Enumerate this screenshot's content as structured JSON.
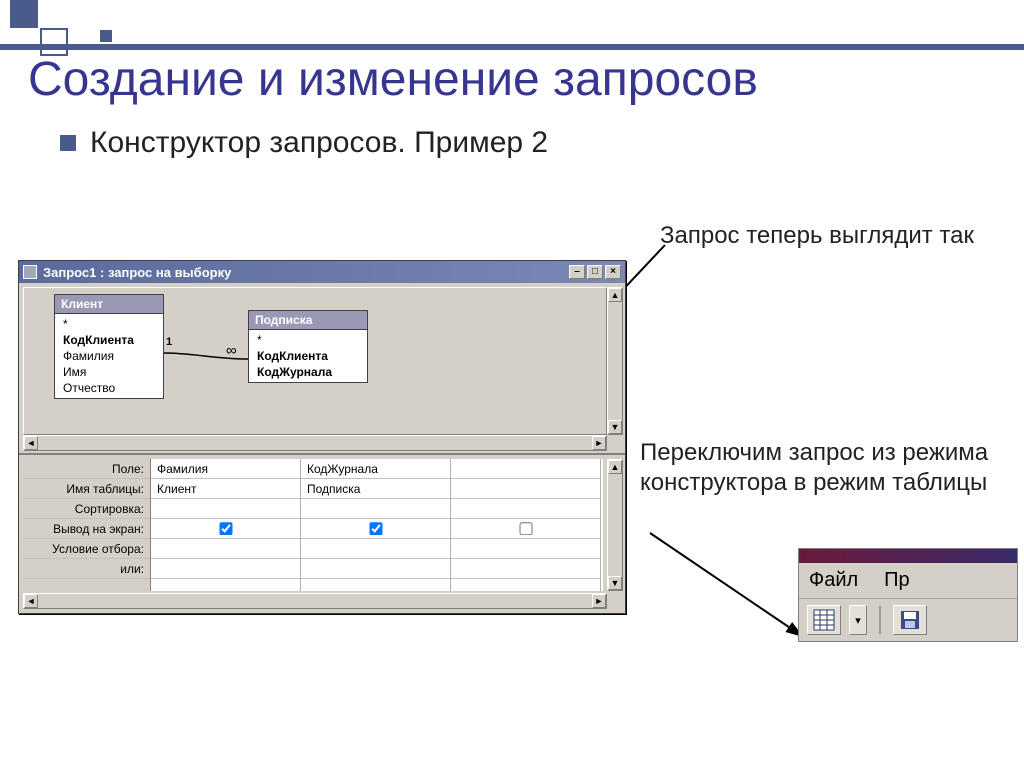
{
  "decoration": {},
  "slide": {
    "title": "Создание и изменение запросов",
    "subtitle": "Конструктор запросов. Пример 2"
  },
  "annotations": {
    "note1": "Запрос теперь выглядит так",
    "note2": "Переключим запрос из режима конструктора в режим таблицы"
  },
  "access_window": {
    "title": "Запрос1 : запрос на выборку",
    "tables": {
      "client": {
        "title": "Клиент",
        "fields": [
          "*",
          "КодКлиента",
          "Фамилия",
          "Имя",
          "Отчество"
        ],
        "bold_indices": [
          1
        ]
      },
      "subscription": {
        "title": "Подписка",
        "fields": [
          "*",
          "КодКлиента",
          "КодЖурнала"
        ],
        "bold_indices": [
          1,
          2
        ]
      }
    },
    "relation": {
      "left": "1",
      "right": "∞"
    },
    "grid_labels": [
      "Поле:",
      "Имя таблицы:",
      "Сортировка:",
      "Вывод на экран:",
      "Условие отбора:",
      "или:"
    ],
    "columns": [
      {
        "field": "Фамилия",
        "table": "Клиент",
        "sort": "",
        "show": true,
        "criteria": "",
        "or": ""
      },
      {
        "field": "КодЖурнала",
        "table": "Подписка",
        "sort": "",
        "show": true,
        "criteria": "",
        "or": ""
      },
      {
        "field": "",
        "table": "",
        "sort": "",
        "show": false,
        "criteria": "",
        "or": ""
      }
    ]
  },
  "toolbar_fragment": {
    "menu": {
      "file": "Файл",
      "other": "Пр"
    },
    "buttons": {
      "view_dropdown": "▾"
    }
  }
}
